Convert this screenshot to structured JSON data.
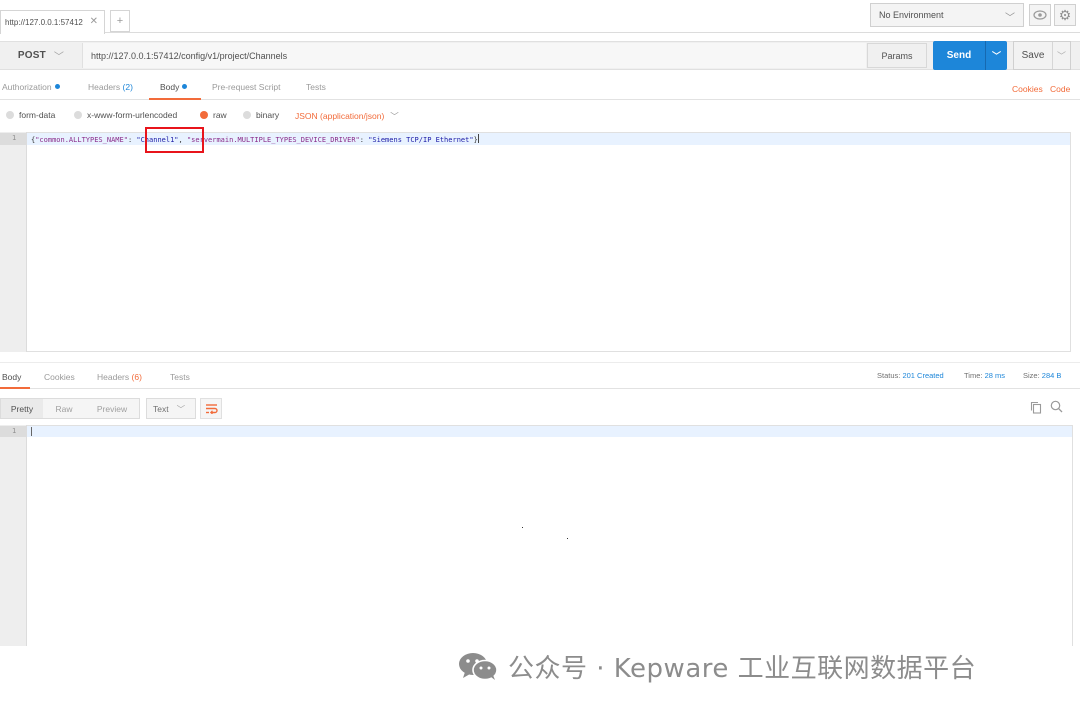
{
  "tabs": {
    "request_tab_title": "http://127.0.0.1:57412",
    "close_glyph": "✕",
    "new_tab_glyph": "+"
  },
  "environment": {
    "selected": "No Environment"
  },
  "request": {
    "method": "POST",
    "url": "http://127.0.0.1:57412/config/v1/project/Channels",
    "params_label": "Params",
    "send_label": "Send",
    "save_label": "Save"
  },
  "request_tabs": {
    "authorization": "Authorization",
    "headers": "Headers",
    "headers_count": "(2)",
    "body": "Body",
    "pre_request": "Pre-request Script",
    "tests": "Tests",
    "cookies": "Cookies",
    "code": "Code"
  },
  "body_types": {
    "form_data": "form-data",
    "urlencoded": "x-www-form-urlencoded",
    "raw": "raw",
    "binary": "binary",
    "content_type": "JSON (application/json)",
    "selected": "raw"
  },
  "editor": {
    "line_number": "1",
    "key1": "\"common.ALLTYPES_NAME\"",
    "value1": "\"Channel1\"",
    "key2": "\"servermain.MULTIPLE_TYPES_DEVICE_DRIVER\"",
    "value2": "\"Siemens TCP/IP Ethernet\"",
    "open_brace": "{",
    "close_brace": "}",
    "colon": ": ",
    "comma": ", "
  },
  "response_tabs": {
    "body": "Body",
    "cookies": "Cookies",
    "headers": "Headers",
    "headers_count": "(6)",
    "tests": "Tests"
  },
  "status": {
    "status_label": "Status:",
    "status_value": "201 Created",
    "time_label": "Time:",
    "time_value": "28 ms",
    "size_label": "Size:",
    "size_value": "284 B"
  },
  "response_toolbar": {
    "pretty": "Pretty",
    "raw": "Raw",
    "preview": "Preview",
    "format": "Text"
  },
  "response_editor": {
    "line_number": "1"
  },
  "watermark": {
    "text": "公众号 · Kepware 工业互联网数据平台"
  },
  "colors": {
    "accent": "#f26b3a",
    "send_blue": "#1d86d9",
    "highlight_box": "#e8141b"
  }
}
